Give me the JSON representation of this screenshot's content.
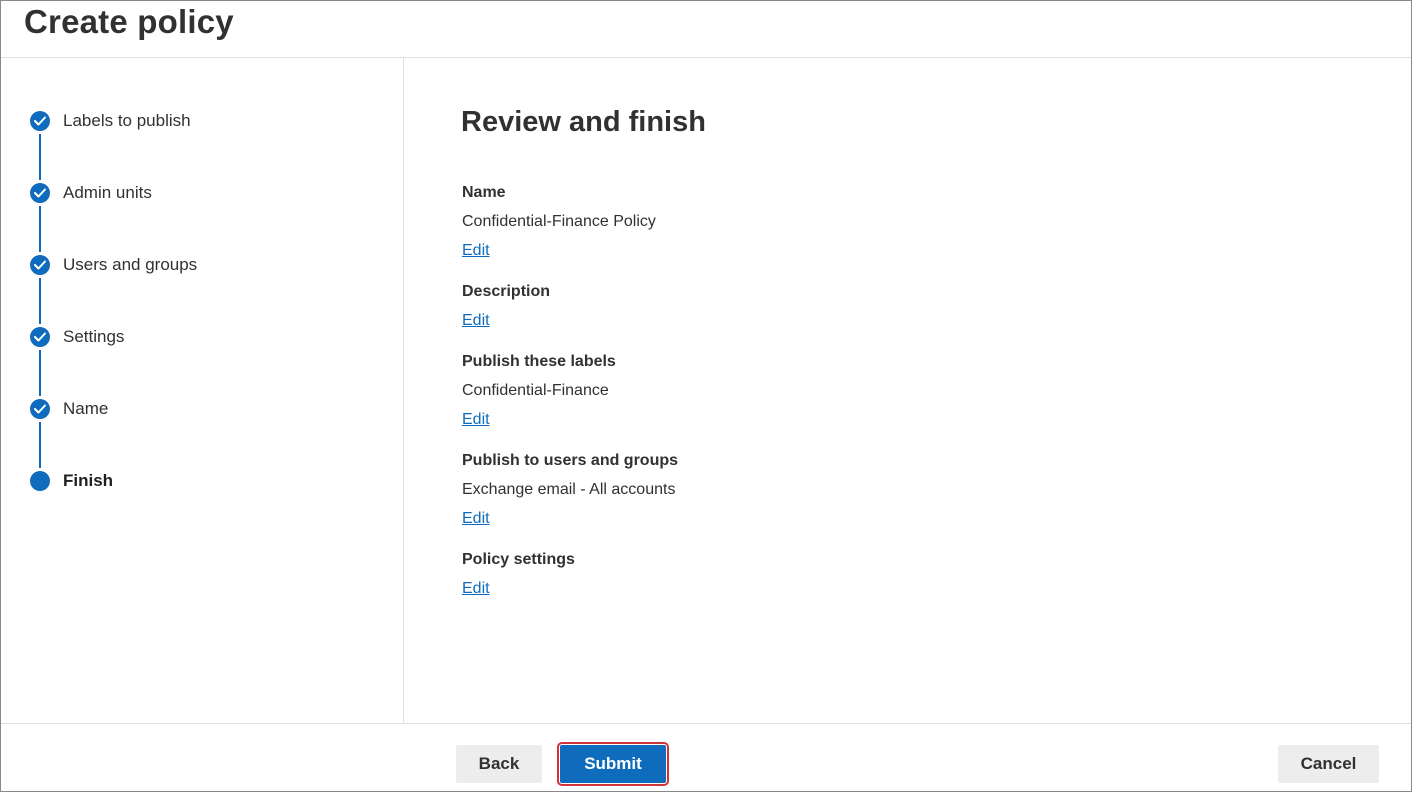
{
  "header": {
    "title": "Create policy"
  },
  "steps": [
    {
      "label": "Labels to publish",
      "state": "completed"
    },
    {
      "label": "Admin units",
      "state": "completed"
    },
    {
      "label": "Users and groups",
      "state": "completed"
    },
    {
      "label": "Settings",
      "state": "completed"
    },
    {
      "label": "Name",
      "state": "completed"
    },
    {
      "label": "Finish",
      "state": "current"
    }
  ],
  "main": {
    "title": "Review and finish",
    "name_title": "Name",
    "name_value": "Confidential-Finance Policy",
    "description_title": "Description",
    "labels_title": "Publish these labels",
    "labels_value": "Confidential-Finance",
    "users_title": "Publish to users and groups",
    "users_value": "Exchange email - All accounts",
    "settings_title": "Policy settings",
    "edit_label": "Edit"
  },
  "footer": {
    "back_label": "Back",
    "submit_label": "Submit",
    "cancel_label": "Cancel"
  },
  "colors": {
    "accent": "#0f6cbd",
    "highlight_border": "#d13438"
  }
}
